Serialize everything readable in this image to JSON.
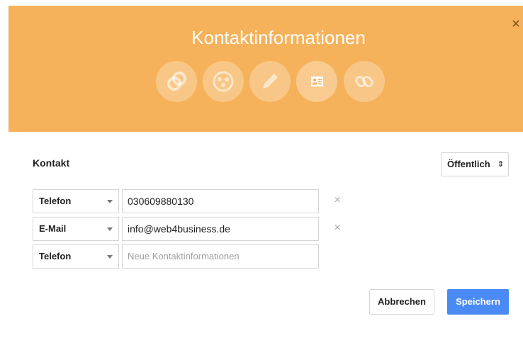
{
  "dialog": {
    "title": "Kontaktinformationen",
    "close_glyph": "×",
    "header_color": "#f6b25a",
    "steps": [
      {
        "icon": "link-circles-icon"
      },
      {
        "icon": "circles-icon"
      },
      {
        "icon": "pencil-icon"
      },
      {
        "icon": "contact-card-icon",
        "active": true
      },
      {
        "icon": "chain-link-icon"
      }
    ]
  },
  "section": {
    "label": "Kontakt",
    "visibility": "Öffentlich",
    "visibility_arrows": "⇕"
  },
  "rows": [
    {
      "type": "Telefon",
      "value": "030609880130",
      "removable": true
    },
    {
      "type": "E-Mail",
      "value": "info@web4business.de",
      "removable": true
    },
    {
      "type": "Telefon",
      "placeholder": "Neue Kontaktinformationen",
      "removable": false
    }
  ],
  "remove_glyph": "×",
  "actions": {
    "cancel": "Abbrechen",
    "save": "Speichern",
    "save_color": "#4a8af4"
  }
}
